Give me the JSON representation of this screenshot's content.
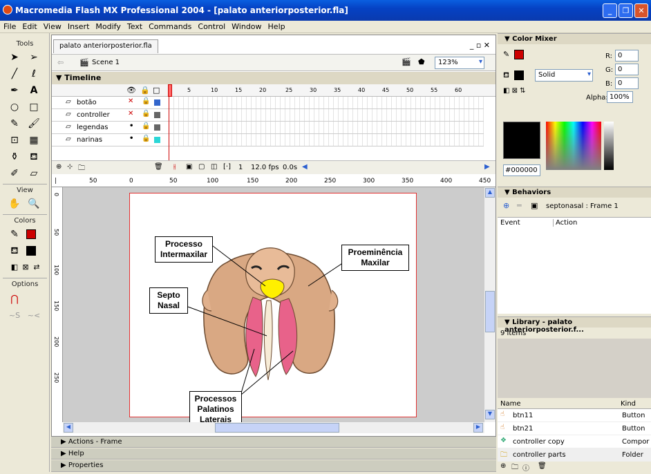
{
  "window": {
    "title": "Macromedia Flash MX Professional 2004 - [palato anteriorposterior.fla]"
  },
  "menu": [
    "File",
    "Edit",
    "View",
    "Insert",
    "Modify",
    "Text",
    "Commands",
    "Control",
    "Window",
    "Help"
  ],
  "tools": {
    "header": "Tools",
    "view_header": "View",
    "colors_header": "Colors",
    "options_header": "Options"
  },
  "document": {
    "tab": "palato anteriorposterior.fla",
    "scene": "Scene 1",
    "zoom": "123%",
    "timeline_label": "Timeline",
    "layers": [
      {
        "name": "botão",
        "visible": "✕"
      },
      {
        "name": "controller",
        "visible": "✕"
      },
      {
        "name": "legendas",
        "visible": "•"
      },
      {
        "name": "narinas",
        "visible": "•"
      }
    ],
    "frame_numbers": [
      "5",
      "10",
      "15",
      "20",
      "25",
      "30",
      "35",
      "40",
      "45",
      "50",
      "55",
      "60"
    ],
    "current_frame": "1",
    "fps": "12.0 fps",
    "time": "0.0s",
    "ruler_marks": [
      "50",
      "0",
      "50",
      "100",
      "150",
      "200",
      "250",
      "300",
      "350",
      "400",
      "450"
    ],
    "vruler_marks": [
      "0",
      "50",
      "100",
      "150",
      "200",
      "250"
    ]
  },
  "callouts": {
    "processo": "Processo Intermaxilar",
    "proeminencia": "Proeminência Maxilar",
    "septo": "Septo Nasal",
    "palatinos": "Processos Palatinos Laterais"
  },
  "bottom_panels": [
    "Actions - Frame",
    "Help",
    "Properties"
  ],
  "color_mixer": {
    "title": "Color Mixer",
    "r_label": "R:",
    "r": "0",
    "g_label": "G:",
    "g": "0",
    "b_label": "B:",
    "b": "0",
    "alpha_label": "Alpha:",
    "alpha": "100%",
    "fill_type": "Solid",
    "hex": "#000000"
  },
  "behaviors": {
    "title": "Behaviors",
    "target": "septonasal : Frame 1",
    "col_event": "Event",
    "col_action": "Action"
  },
  "library": {
    "title": "Library - palato anteriorposterior.f...",
    "count": "9 items",
    "col_name": "Name",
    "col_kind": "Kind",
    "items": [
      {
        "name": "btn11",
        "kind": "Button"
      },
      {
        "name": "btn21",
        "kind": "Button"
      },
      {
        "name": "controller copy",
        "kind": "Compor"
      },
      {
        "name": "controller parts",
        "kind": "Folder"
      }
    ]
  },
  "colors": {
    "accent": "#0a5fe0",
    "stroke": "#cc0000",
    "fill": "#000000",
    "palate_pink": "#e8628a",
    "skin": "#d9a883"
  }
}
